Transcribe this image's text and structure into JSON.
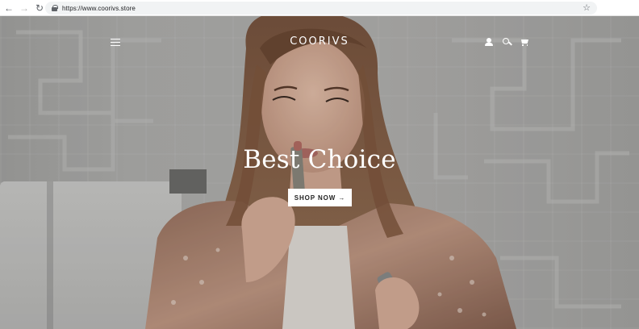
{
  "browser": {
    "url": "https://www.coorivs.store",
    "back_icon": "arrow-left",
    "forward_icon": "arrow-right",
    "reload_icon": "reload",
    "lock_icon": "lock",
    "bookmark_icon": "star"
  },
  "store": {
    "logo": "COORIVS",
    "menu_icon": "hamburger",
    "account_icon": "user",
    "search_icon": "search",
    "cart_icon": "cart"
  },
  "hero": {
    "title": "Best Choice",
    "cta_label": "SHOP NOW →"
  },
  "colors": {
    "hero_text": "#ffffff",
    "button_bg": "#ffffff",
    "button_text": "#222222"
  }
}
